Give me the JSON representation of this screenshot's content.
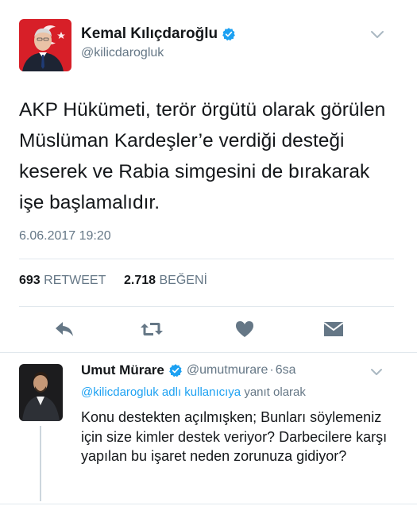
{
  "tweet": {
    "author_name": "Kemal Kılıçdaroğlu",
    "author_handle": "@kilicdarogluk",
    "text": "AKP Hükümeti, terör örgütü olarak görülen Müslüman Kardeşler’e verdiği desteği keserek ve Rabia simgesini de bırakarak işe başlamalıdır.",
    "timestamp": "6.06.2017 19:20",
    "retweet_count": "693",
    "retweet_label": "RETWEET",
    "like_count": "2.718",
    "like_label": "BEĞENİ"
  },
  "actions": [
    "reply-icon",
    "retweet-icon",
    "like-icon",
    "message-icon"
  ],
  "reply": {
    "author_name": "Umut Mürare",
    "author_handle": "@umutmurare",
    "time": "6sa",
    "replying_mention": "@kilicdarogluk adlı kullanıcıya",
    "replying_suffix": "yanıt olarak",
    "text": "Konu destekten açılmışken; Bunları söylemeniz için size kimler destek veriyor? Darbecilere karşı yapılan bu işaret neden zorunuza gidiyor?"
  },
  "colors": {
    "link": "#1da1f2",
    "secondary_text": "#657786",
    "verified": "#1da1f2",
    "action_icon": "#657786"
  }
}
